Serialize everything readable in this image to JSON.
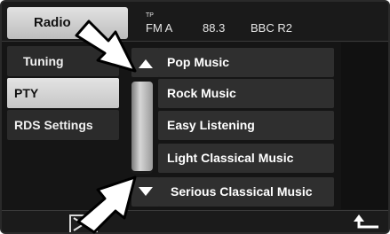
{
  "header": {
    "tab_label": "Radio",
    "tp_label": "TP",
    "band": "FM A",
    "frequency": "88.3",
    "station": "BBC R2"
  },
  "sidebar": {
    "items": [
      {
        "label": "Tuning"
      },
      {
        "label": "PTY"
      },
      {
        "label": "RDS Settings"
      }
    ]
  },
  "pty_list": {
    "items": [
      {
        "label": "Pop Music"
      },
      {
        "label": "Rock Music"
      },
      {
        "label": "Easy Listening"
      },
      {
        "label": "Light Classical Music"
      },
      {
        "label": "Serious Classical Music"
      }
    ]
  },
  "icons": {
    "scroll_up": "up-arrow-icon",
    "scroll_down": "down-arrow-icon",
    "close": "close-icon",
    "back": "return-arrow-icon"
  },
  "colors": {
    "background": "#151515",
    "selected_item": "#d0d0d0",
    "text": "#ffffff"
  }
}
